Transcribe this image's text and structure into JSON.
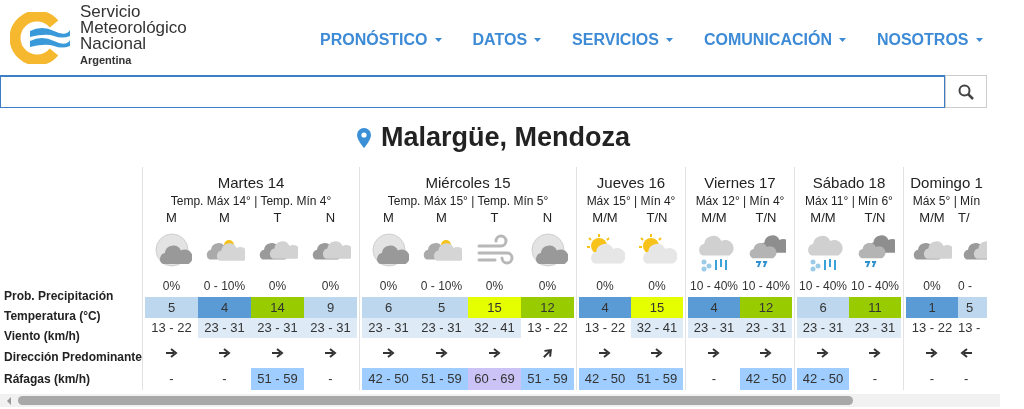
{
  "header": {
    "logo_lines": [
      "Servicio",
      "Meteorológico",
      "Nacional"
    ],
    "logo_subtitle": "Argentina",
    "nav": [
      {
        "label": "PRONÓSTICO"
      },
      {
        "label": "DATOS"
      },
      {
        "label": "SERVICIOS"
      },
      {
        "label": "COMUNICACIÓN"
      },
      {
        "label": "NOSOTROS"
      }
    ]
  },
  "location": "Malargüe, Mendoza",
  "row_labels": [
    "Prob. Precipitación",
    "Temperatura (°C)",
    "Viento (km/h)",
    "Dirección Predominante",
    "Ráfagas (km/h)"
  ],
  "days": [
    {
      "name": "Martes 14",
      "summary": "Temp. Máx 14° | Temp. Mín 4°",
      "slots": [
        {
          "period": "M",
          "kind": "night-cloudy",
          "precip": "0%",
          "temp": {
            "value": "5",
            "color": "#bdd7ee"
          },
          "wind": {
            "value": "13 - 22",
            "color": "#ffffff"
          },
          "arrow": {
            "kind": "east"
          },
          "gusts": {
            "value": "-"
          }
        },
        {
          "period": "M",
          "kind": "partly-cloudy",
          "precip": "0 - 10%",
          "temp": {
            "value": "4",
            "color": "#5b9bd5"
          },
          "wind": {
            "value": "23 - 31",
            "color": "#deebf7"
          },
          "arrow": {
            "kind": "east"
          },
          "gusts": {
            "value": "-"
          }
        },
        {
          "period": "T",
          "kind": "cloudy",
          "precip": "0%",
          "temp": {
            "value": "14",
            "color": "#99cc00"
          },
          "wind": {
            "value": "23 - 31",
            "color": "#deebf7"
          },
          "arrow": {
            "kind": "east"
          },
          "gusts": {
            "value": "51 - 59",
            "color": "#9fcdff"
          }
        },
        {
          "period": "N",
          "kind": "cloudy",
          "precip": "0%",
          "temp": {
            "value": "9",
            "color": "#bdd7ee"
          },
          "wind": {
            "value": "23 - 31",
            "color": "#deebf7"
          },
          "arrow": {
            "kind": "east"
          },
          "gusts": {
            "value": "-"
          }
        }
      ]
    },
    {
      "name": "Miércoles 15",
      "summary": "Temp. Máx 15° | Temp. Mín 5°",
      "slots": [
        {
          "period": "M",
          "kind": "night-cloudy",
          "precip": "0%",
          "temp": {
            "value": "6",
            "color": "#bdd7ee"
          },
          "wind": {
            "value": "23 - 31",
            "color": "#deebf7"
          },
          "arrow": {
            "kind": "east"
          },
          "gusts": {
            "value": "42 - 50",
            "color": "#9fcdff"
          }
        },
        {
          "period": "M",
          "kind": "partly-cloudy",
          "precip": "0 - 10%",
          "temp": {
            "value": "5",
            "color": "#bdd7ee"
          },
          "wind": {
            "value": "23 - 31",
            "color": "#deebf7"
          },
          "arrow": {
            "kind": "east"
          },
          "gusts": {
            "value": "51 - 59",
            "color": "#9fcdff"
          }
        },
        {
          "period": "T",
          "kind": "wind",
          "precip": "0%",
          "temp": {
            "value": "15",
            "color": "#e6ff00"
          },
          "wind": {
            "value": "32 - 41",
            "color": "#deebf7"
          },
          "arrow": {
            "kind": "east"
          },
          "gusts": {
            "value": "60 - 69",
            "color": "#cbc3f5"
          }
        },
        {
          "period": "N",
          "kind": "night-cloudy",
          "precip": "0%",
          "temp": {
            "value": "12",
            "color": "#99cc00"
          },
          "wind": {
            "value": "13 - 22",
            "color": "#ffffff"
          },
          "arrow": {
            "kind": "northeast"
          },
          "gusts": {
            "value": "51 - 59",
            "color": "#9fcdff"
          }
        }
      ]
    },
    {
      "name": "Jueves 16",
      "summary": "Máx 15° | Mín 4°",
      "slots": [
        {
          "period": "M/M",
          "kind": "sunny-cloudy",
          "precip": "0%",
          "temp": {
            "value": "4",
            "color": "#5b9bd5"
          },
          "wind": {
            "value": "13 - 22",
            "color": "#ffffff"
          },
          "arrow": {
            "kind": "east"
          },
          "gusts": {
            "value": "42 - 50",
            "color": "#9fcdff"
          }
        },
        {
          "period": "T/N",
          "kind": "sunny-cloudy",
          "precip": "0%",
          "temp": {
            "value": "15",
            "color": "#e6ff00"
          },
          "wind": {
            "value": "32 - 41",
            "color": "#deebf7"
          },
          "arrow": {
            "kind": "east"
          },
          "gusts": {
            "value": "51 - 59",
            "color": "#9fcdff"
          }
        }
      ]
    },
    {
      "name": "Viernes 17",
      "summary": "Máx 12° | Mín 4°",
      "slots": [
        {
          "period": "M/M",
          "kind": "rain-snow",
          "precip": "10 - 40%",
          "temp": {
            "value": "4",
            "color": "#5b9bd5"
          },
          "wind": {
            "value": "23 - 31",
            "color": "#deebf7"
          },
          "arrow": {
            "kind": "east"
          },
          "gusts": {
            "value": "-"
          }
        },
        {
          "period": "T/N",
          "kind": "storm",
          "precip": "10 - 40%",
          "temp": {
            "value": "12",
            "color": "#99cc00"
          },
          "wind": {
            "value": "23 - 31",
            "color": "#deebf7"
          },
          "arrow": {
            "kind": "east"
          },
          "gusts": {
            "value": "42 - 50",
            "color": "#9fcdff"
          }
        }
      ]
    },
    {
      "name": "Sábado 18",
      "summary": "Máx 11° | Mín 6°",
      "slots": [
        {
          "period": "M/M",
          "kind": "rain-snow",
          "precip": "10 - 40%",
          "temp": {
            "value": "6",
            "color": "#bdd7ee"
          },
          "wind": {
            "value": "23 - 31",
            "color": "#deebf7"
          },
          "arrow": {
            "kind": "east"
          },
          "gusts": {
            "value": "42 - 50",
            "color": "#9fcdff"
          }
        },
        {
          "period": "T/N",
          "kind": "storm",
          "precip": "10 - 40%",
          "temp": {
            "value": "11",
            "color": "#99cc00"
          },
          "wind": {
            "value": "23 - 31",
            "color": "#deebf7"
          },
          "arrow": {
            "kind": "east"
          },
          "gusts": {
            "value": "-"
          }
        }
      ]
    },
    {
      "name": "Domingo 1",
      "summary": "Máx 5° | Mín",
      "slots": [
        {
          "period": "M/M",
          "kind": "cloudy",
          "precip": "0%",
          "temp": {
            "value": "1",
            "color": "#5b9bd5"
          },
          "wind": {
            "value": "13 - 22",
            "color": "#ffffff"
          },
          "arrow": {
            "kind": "east"
          },
          "gusts": {
            "value": "-"
          }
        },
        {
          "period": "T/",
          "kind": "cloudy",
          "precip": "0 -",
          "temp": {
            "value": "5",
            "color": "#bdd7ee"
          },
          "wind": {
            "value": "13 -",
            "color": "#ffffff"
          },
          "arrow": {
            "kind": "west"
          },
          "gusts": {
            "value": "-"
          }
        }
      ]
    }
  ]
}
